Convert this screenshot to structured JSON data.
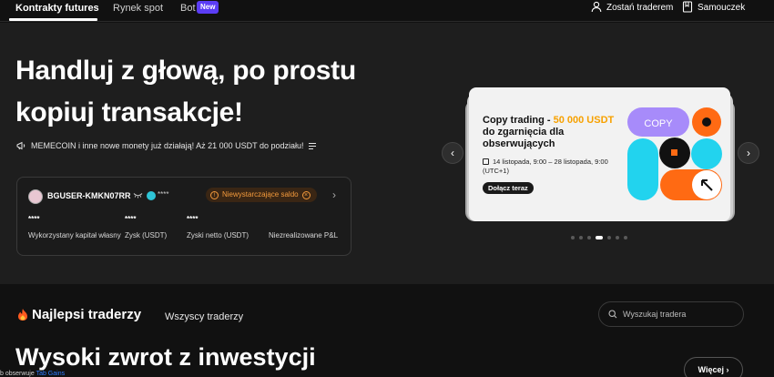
{
  "nav": {
    "tabs": [
      "Kontrakty futures",
      "Rynek spot",
      "Bot"
    ],
    "new_badge": "New",
    "become_trader": "Zostań traderem",
    "tutorial": "Samouczek"
  },
  "hero": {
    "headline": "Handluj z głową, po prostu kopiuj transakcje!",
    "promo": "MEMECOIN i inne nowe monety już działają! Aż 21 000 USDT do podziału!"
  },
  "account": {
    "username": "BGUSER-KMKN07RR",
    "vip_hidden": "****",
    "warning": "Niewystarczające saldo",
    "stats": [
      {
        "value": "****",
        "label": "Wykorzystany kapitał własny"
      },
      {
        "value": "****",
        "label": "Zysk (USDT)"
      },
      {
        "value": "****",
        "label": "Zyski netto (USDT)"
      },
      {
        "value": "",
        "label": "Niezrealizowane P&L"
      }
    ]
  },
  "carousel": {
    "title_prefix": "Copy trading - ",
    "title_highlight": "50 000 USDT",
    "title_suffix": " do zgarnięcia dla obserwujących",
    "date": "14 listopada, 9:00 – 28 listopada, 9:00 (UTC+1)",
    "join": "Dołącz teraz",
    "art_label": "COPY",
    "slide_count": 7,
    "active_index": 3
  },
  "traders": {
    "title": "Najlepsi traderzy",
    "tab_all": "Wszyscy traderzy",
    "search_placeholder": "Wyszukaj tradera",
    "sub_heading": "Wysoki zwrot z inwestycji",
    "more": "Więcej",
    "bottom_left": "b obserwuje",
    "bottom_link": "Tab Gains"
  },
  "colors": {
    "background": "#1e1e1e",
    "accent_orange": "#f7a100",
    "purple": "#a78bfa",
    "cyan": "#22d3ee",
    "badge": "#5b3df5"
  }
}
